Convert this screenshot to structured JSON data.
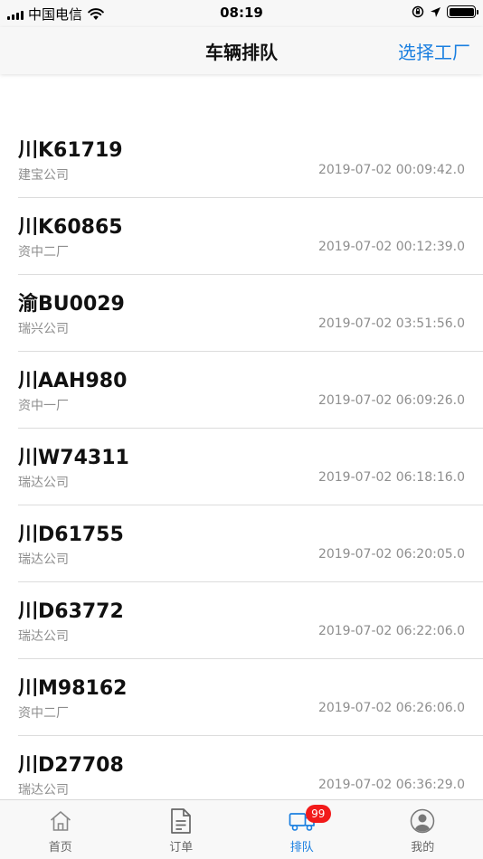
{
  "status_bar": {
    "carrier": "中国电信",
    "time": "08:19"
  },
  "nav": {
    "title": "车辆排队",
    "action": "选择工厂"
  },
  "queue": [
    {
      "plate": "川K61719",
      "company": "建宝公司",
      "time": "2019-07-02 00:09:42.0"
    },
    {
      "plate": "川K60865",
      "company": "资中二厂",
      "time": "2019-07-02 00:12:39.0"
    },
    {
      "plate": "渝BU0029",
      "company": "瑞兴公司",
      "time": "2019-07-02 03:51:56.0"
    },
    {
      "plate": "川AAH980",
      "company": "资中一厂",
      "time": "2019-07-02 06:09:26.0"
    },
    {
      "plate": "川W74311",
      "company": "瑞达公司",
      "time": "2019-07-02 06:18:16.0"
    },
    {
      "plate": "川D61755",
      "company": "瑞达公司",
      "time": "2019-07-02 06:20:05.0"
    },
    {
      "plate": "川D63772",
      "company": "瑞达公司",
      "time": "2019-07-02 06:22:06.0"
    },
    {
      "plate": "川M98162",
      "company": "资中二厂",
      "time": "2019-07-02 06:26:06.0"
    },
    {
      "plate": "川D27708",
      "company": "瑞达公司",
      "time": "2019-07-02 06:36:29.0"
    }
  ],
  "tabs": [
    {
      "label": "首页",
      "icon": "home-icon"
    },
    {
      "label": "订单",
      "icon": "document-icon"
    },
    {
      "label": "排队",
      "icon": "truck-icon",
      "badge": "99"
    },
    {
      "label": "我的",
      "icon": "profile-icon"
    }
  ],
  "colors": {
    "accent": "#1a7fe0",
    "badge": "#f21a1a"
  }
}
